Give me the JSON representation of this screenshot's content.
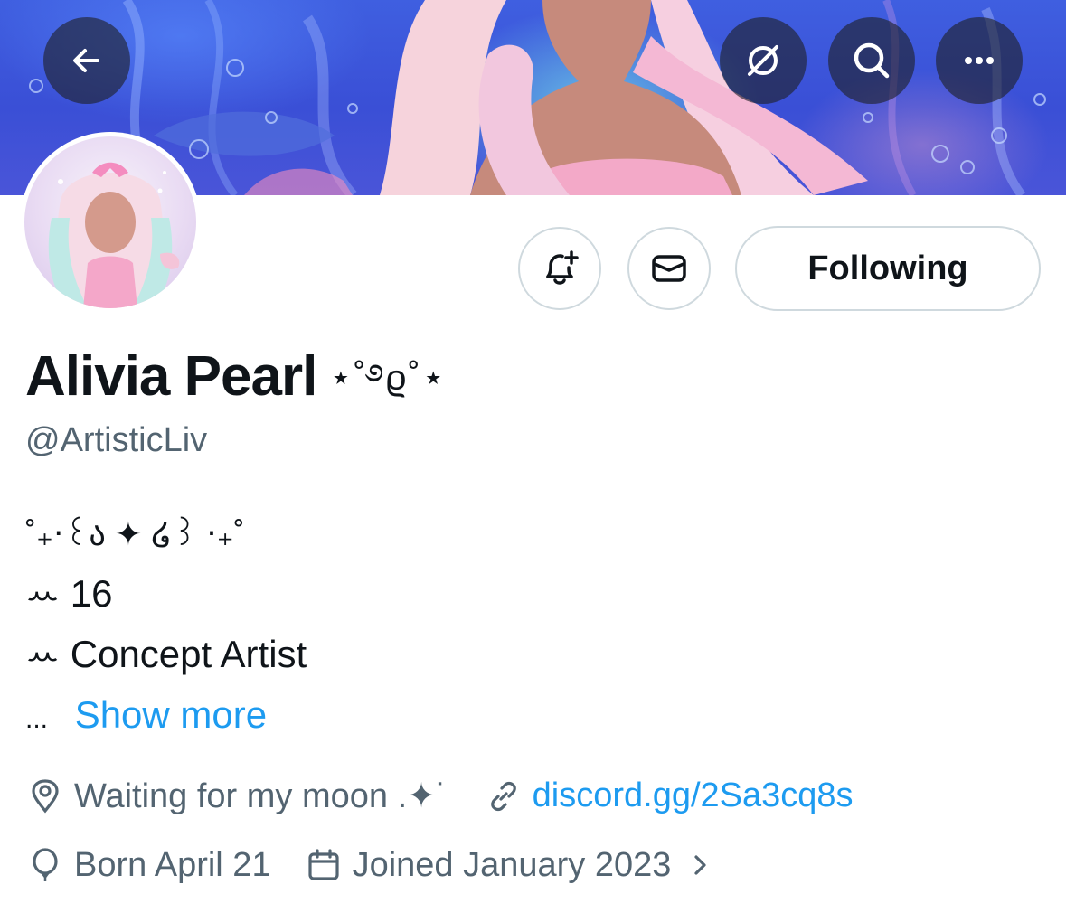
{
  "header": {
    "back_icon": "arrow-left-icon",
    "grok_icon": "grok-icon",
    "search_icon": "search-icon",
    "more_icon": "more-dots-icon"
  },
  "actions": {
    "notify_icon": "bell-plus-icon",
    "message_icon": "envelope-icon",
    "following_label": "Following"
  },
  "profile": {
    "name": "Alivia Pearl",
    "name_decoration": "⋆˚࿔ϱ˚⋆",
    "handle": "@ArtisticLiv"
  },
  "bio": {
    "line1": "˚₊‧꒰ა ✦ ໒꒱ ‧₊˚",
    "line2": "ꕀ 16",
    "line3": "ꕀ Concept Artist",
    "ellipsis": "...",
    "show_more": "Show more"
  },
  "meta": {
    "location": "Waiting for my moon .✦˙",
    "website": "discord.gg/2Sa3cq8s",
    "birthday": "Born April 21",
    "joined": "Joined January 2023"
  },
  "colors": {
    "accent": "#1d9bf0",
    "secondary_text": "#536471",
    "border": "#cfd9de"
  }
}
